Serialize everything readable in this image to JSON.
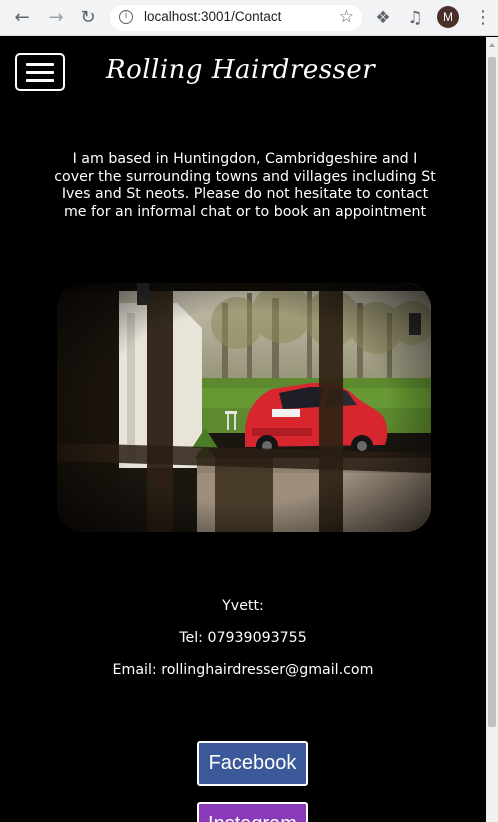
{
  "browser": {
    "url": "localhost:3001/Contact",
    "avatar_initial": "M"
  },
  "header": {
    "brand": "Rolling Hairdresser",
    "menu_icon": "hamburger-icon"
  },
  "intro_text": "I am based in Huntingdon, Cambridgeshire and I cover the surrounding towns and villages including St Ives and St neots. Please do not hesitate to contact me for an informal chat or to book an appointment",
  "contact": {
    "name": "Yvett:",
    "tel": "Tel: 07939093755",
    "email": "Email: rollinghairdresser@gmail.com"
  },
  "social": {
    "facebook": "Facebook",
    "instagram": "Instagram",
    "facebook_color": "#3b5998",
    "instagram_color": "#8a3ab9"
  },
  "colors": {
    "page_bg": "#000000",
    "text": "#ffffff"
  }
}
